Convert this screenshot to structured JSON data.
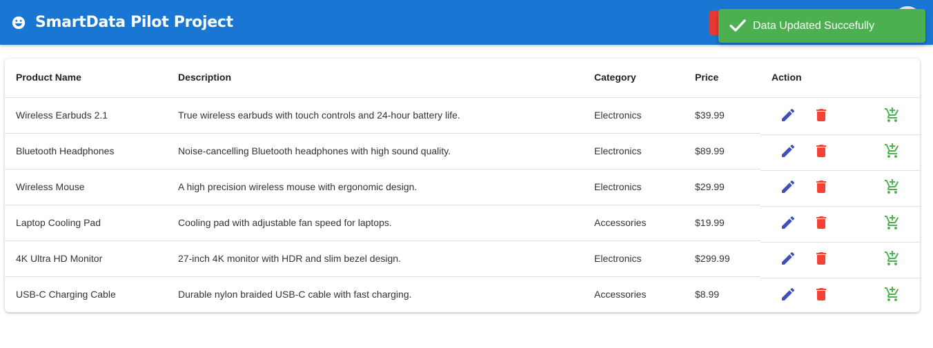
{
  "app": {
    "title": "SmartData Pilot Project"
  },
  "toast": {
    "message": "Data Updated Succefully"
  },
  "table": {
    "columns": [
      "Product Name",
      "Description",
      "Category",
      "Price",
      "Action"
    ],
    "rows": [
      {
        "name": "Wireless Earbuds 2.1",
        "description": "True wireless earbuds with touch controls and 24-hour battery life.",
        "category": "Electronics",
        "price": "$39.99"
      },
      {
        "name": "Bluetooth Headphones",
        "description": "Noise-cancelling Bluetooth headphones with high sound quality.",
        "category": "Electronics",
        "price": "$89.99"
      },
      {
        "name": "Wireless Mouse",
        "description": "A high precision wireless mouse with ergonomic design.",
        "category": "Electronics",
        "price": "$29.99"
      },
      {
        "name": "Laptop Cooling Pad",
        "description": "Cooling pad with adjustable fan speed for laptops.",
        "category": "Accessories",
        "price": "$19.99"
      },
      {
        "name": "4K Ultra HD Monitor",
        "description": "27-inch 4K monitor with HDR and slim bezel design.",
        "category": "Electronics",
        "price": "$299.99"
      },
      {
        "name": "USB-C Charging Cable",
        "description": "Durable nylon braided USB-C cable with fast charging.",
        "category": "Accessories",
        "price": "$8.99"
      }
    ]
  },
  "icons": {
    "edit": "pencil-icon",
    "delete": "trash-icon",
    "add_to_cart": "add-shopping-cart-icon",
    "toast": "check-icon",
    "logo": "smiley-face-icon"
  },
  "colors": {
    "appbar": "#1976d2",
    "toast": "#4caf50",
    "edit": "#3f51b5",
    "delete": "#f44336",
    "cart": "#4caf50"
  }
}
